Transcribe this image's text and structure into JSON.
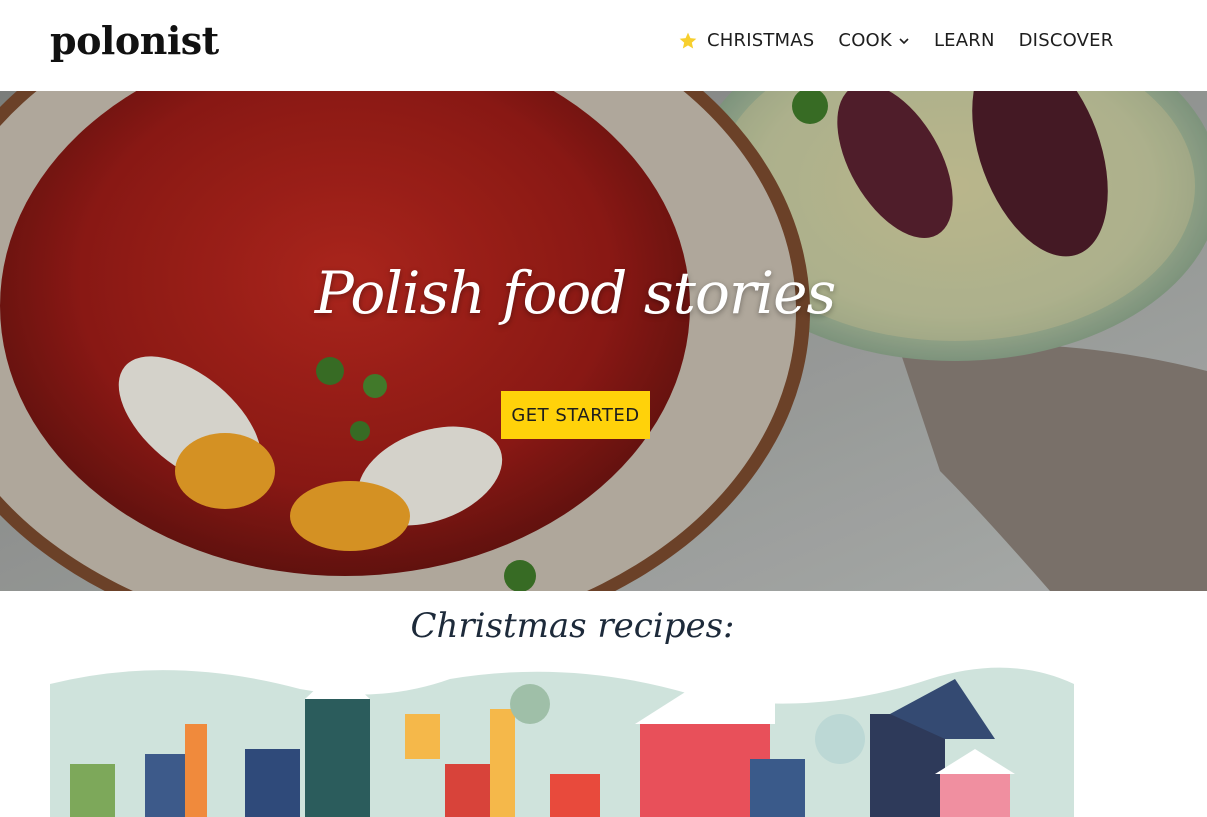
{
  "header": {
    "logo": "polonist",
    "nav": [
      {
        "label": "CHRISTMAS",
        "icon": "star-icon"
      },
      {
        "label": "COOK",
        "icon": "chevron-down-icon"
      },
      {
        "label": "LEARN"
      },
      {
        "label": "DISCOVER"
      }
    ]
  },
  "hero": {
    "title": "Polish food stories",
    "cta_label": "GET STARTED"
  },
  "christmas": {
    "title": "Christmas recipes:"
  },
  "colors": {
    "accent": "#ffd20a",
    "text": "#1e1e1e",
    "soup": "#a8201a"
  }
}
